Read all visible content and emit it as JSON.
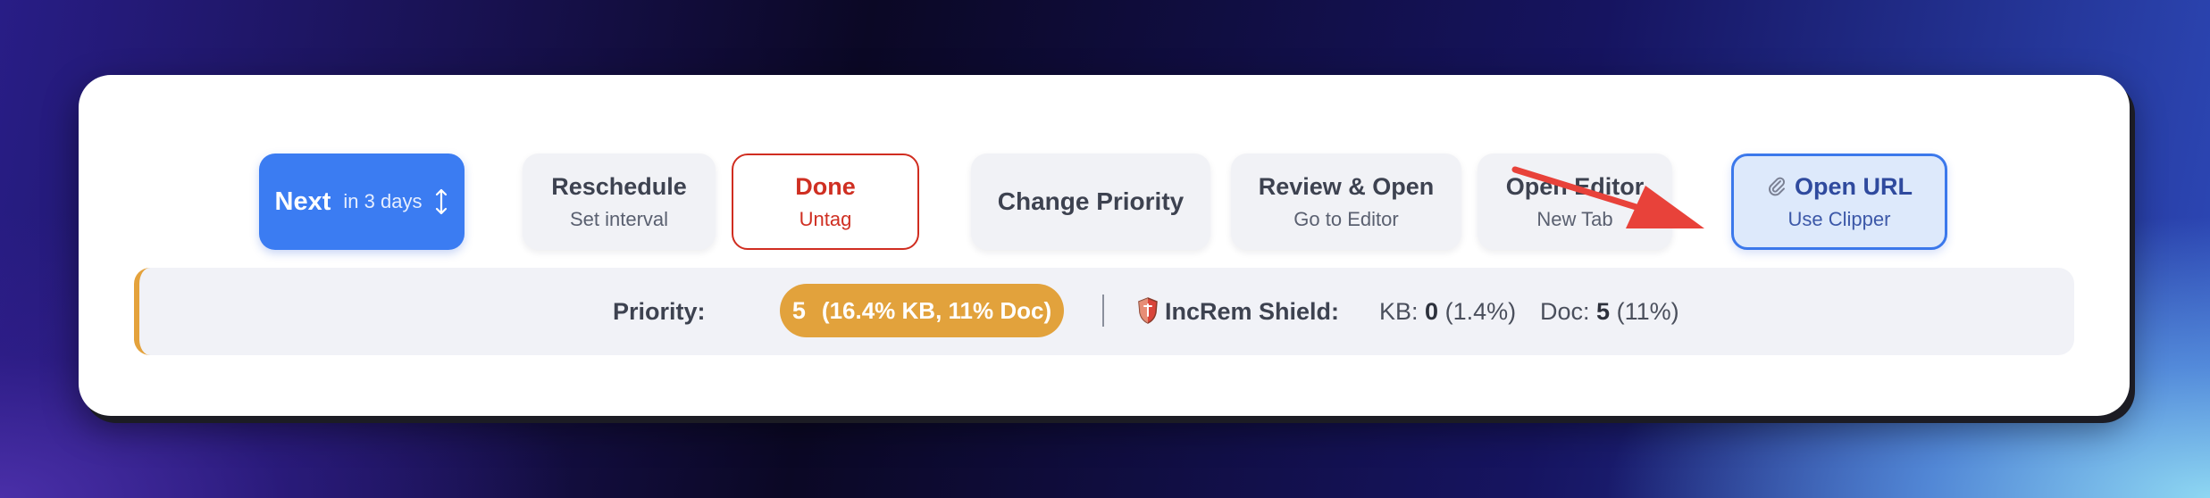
{
  "toolbar": {
    "next": {
      "label": "Next",
      "when": "in 3 days"
    },
    "reschedule": {
      "label": "Reschedule",
      "sub": "Set interval"
    },
    "done": {
      "label": "Done",
      "sub": "Untag"
    },
    "change_priority": {
      "label": "Change Priority"
    },
    "review_open": {
      "label": "Review & Open",
      "sub": "Go to Editor"
    },
    "open_editor": {
      "label": "Open Editor",
      "sub": "New Tab"
    },
    "open_url": {
      "label": "Open URL",
      "sub": "Use Clipper"
    }
  },
  "info_bar": {
    "priority_label": "Priority:",
    "priority_value": "5",
    "priority_detail": "(16.4% KB, 11% Doc)",
    "shield_label": "IncRem Shield:",
    "kb_label": "KB:",
    "kb_value": "0",
    "kb_pct": "(1.4%)",
    "doc_label": "Doc:",
    "doc_value": "5",
    "doc_pct": "(11%)"
  },
  "icons": {
    "next_arrow": "up-down-arrow-icon",
    "clip": "paperclip-icon",
    "shield": "shield-icon",
    "pointer": "red-pointer-arrow"
  },
  "colors": {
    "primary": "#3b7cf2",
    "danger": "#d02d20",
    "priority": "#e2a23c",
    "highlight": "#3b78eb",
    "annotation": "#e8423a"
  }
}
